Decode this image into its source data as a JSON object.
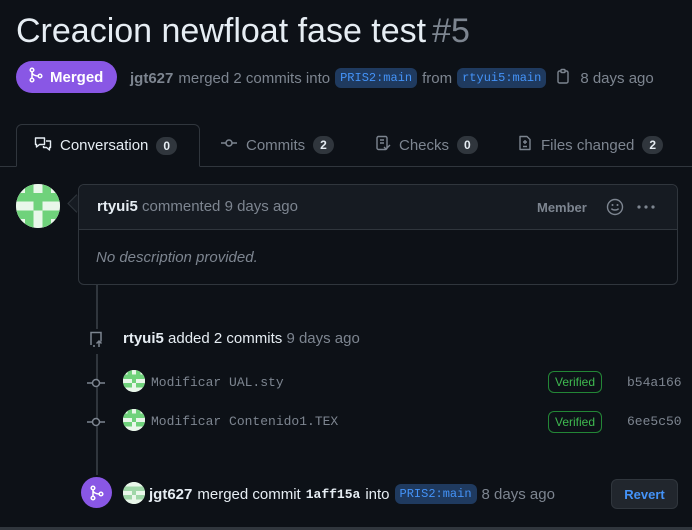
{
  "pr": {
    "title": "Creacion newfloat fase test",
    "number": "#5",
    "state_label": "Merged",
    "author": "jgt627",
    "merged_text": "merged 2 commits into",
    "base_branch": "PRIS2:main",
    "from_text": "from",
    "head_branch": "rtyui5:main",
    "time": "8 days ago"
  },
  "tabs": [
    {
      "label": "Conversation",
      "count": "0"
    },
    {
      "label": "Commits",
      "count": "2"
    },
    {
      "label": "Checks",
      "count": "0"
    },
    {
      "label": "Files changed",
      "count": "2"
    }
  ],
  "comment": {
    "author": "rtyui5",
    "action": "commented",
    "time": "9 days ago",
    "role": "Member",
    "body": "No description provided."
  },
  "commits_event": {
    "author": "rtyui5",
    "action": "added 2 commits",
    "time": "9 days ago",
    "commits": [
      {
        "message": "Modificar UAL.sty",
        "status": "Verified",
        "sha": "b54a166"
      },
      {
        "message": "Modificar Contenido1.TEX",
        "status": "Verified",
        "sha": "6ee5c50"
      }
    ]
  },
  "merge_event": {
    "author": "jgt627",
    "action": "merged commit",
    "sha": "1aff15a",
    "into_text": "into",
    "branch": "PRIS2:main",
    "time": "8 days ago",
    "revert_label": "Revert"
  },
  "colors": {
    "background": "#0d1117",
    "merged_purple": "#8957e5",
    "verified_green": "#3fb950",
    "link_blue": "#4493f8"
  }
}
